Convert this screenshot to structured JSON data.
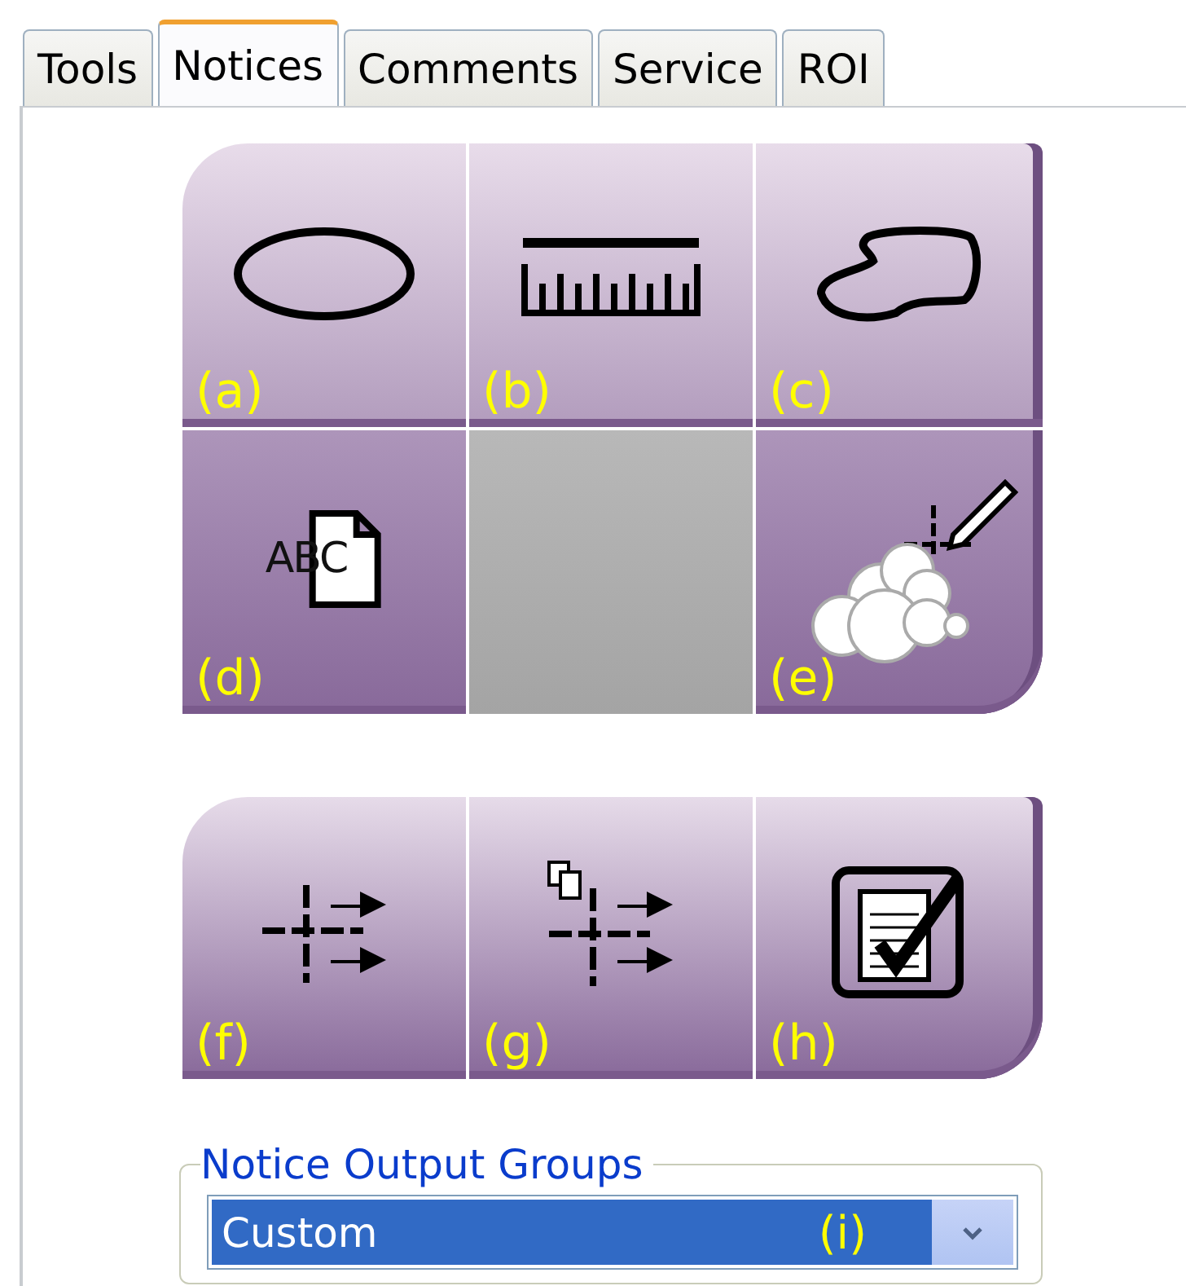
{
  "tabs": [
    {
      "label": "Tools",
      "selected": false
    },
    {
      "label": "Notices",
      "selected": true
    },
    {
      "label": "Comments",
      "selected": false
    },
    {
      "label": "Service",
      "selected": false
    },
    {
      "label": "ROI",
      "selected": false
    }
  ],
  "tool_grid": [
    {
      "label": "(a)",
      "disabled": false
    },
    {
      "label": "(b)",
      "disabled": false
    },
    {
      "label": "(c)",
      "disabled": false
    },
    {
      "label": "(d)",
      "disabled": false,
      "icon_text": "ABC"
    },
    {
      "disabled": true
    },
    {
      "label": "(e)",
      "disabled": false
    }
  ],
  "output_buttons": [
    {
      "label": "(f)",
      "disabled": false
    },
    {
      "label": "(g)",
      "disabled": false
    },
    {
      "label": "(h)",
      "disabled": false
    }
  ],
  "output_groups": {
    "title": "Notice Output Groups",
    "value": "Custom",
    "annotation": "(i)"
  }
}
